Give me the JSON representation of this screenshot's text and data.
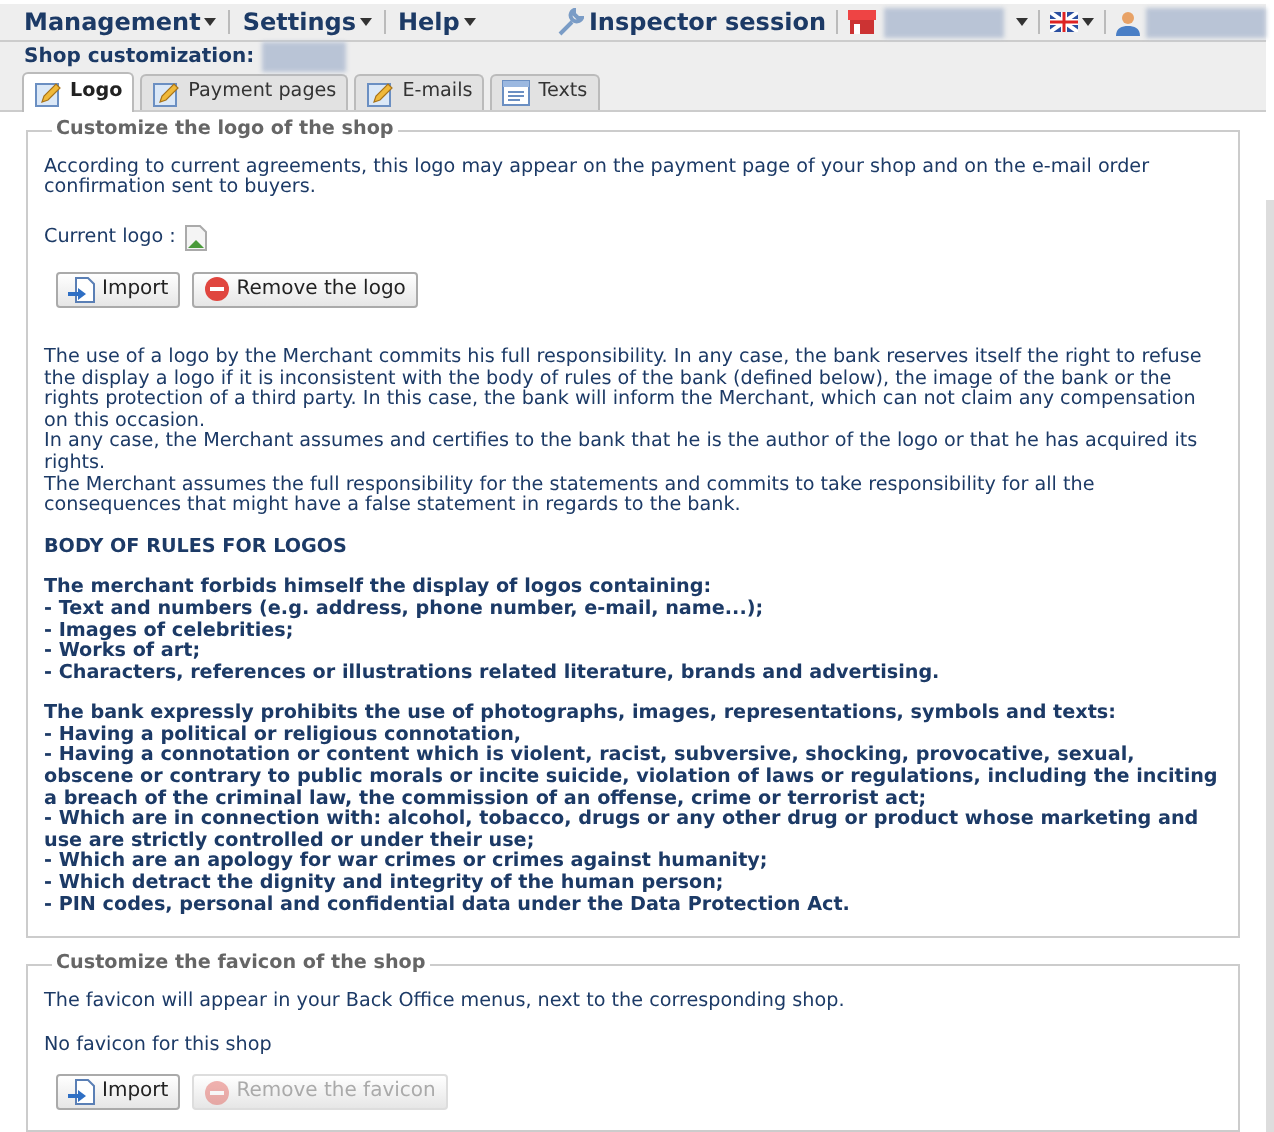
{
  "menu": [
    {
      "label": "Management"
    },
    {
      "label": "Settings"
    },
    {
      "label": "Help"
    }
  ],
  "session": {
    "label": "Inspector session"
  },
  "page_title": {
    "label": "Shop customization:"
  },
  "tabs": [
    {
      "label": "Logo",
      "selected": true,
      "kind": "edit"
    },
    {
      "label": "Payment pages",
      "selected": false,
      "kind": "edit"
    },
    {
      "label": "E-mails",
      "selected": false,
      "kind": "edit"
    },
    {
      "label": "Texts",
      "selected": false,
      "kind": "list"
    }
  ],
  "logo_section": {
    "legend": "Customize the logo of the shop",
    "intro": "According to current agreements, this logo may appear on the payment page of your shop and on the e-mail order confirmation sent to buyers.",
    "current_logo_label": "Current logo :",
    "buttons": [
      {
        "label": "Import",
        "kind": "import",
        "disabled": false
      },
      {
        "label": "Remove the logo",
        "kind": "remove",
        "disabled": false
      }
    ],
    "paragraphs": [
      "The use of a logo by the Merchant commits his full responsibility. In any case, the bank reserves itself the right to refuse the display a logo if it is inconsistent with the body of rules of the bank (defined below), the image of the bank or the rights protection of a third party. In this case, the bank will inform the Merchant, which can not claim any compensation on this occasion.",
      "In any case, the Merchant assumes and certifies to the bank that he is the author of the logo or that he has acquired its rights.",
      "The Merchant assumes the full responsibility for the statements and commits to take responsibility for all the consequences that might have a false statement in regards to the bank."
    ],
    "rules_title": "BODY OF RULES FOR LOGOS",
    "rule_groups": [
      {
        "heading": "The merchant forbids himself the display of logos containing:",
        "items": [
          "- Text and numbers (e.g. address, phone number, e-mail, name...);",
          "- Images of celebrities;",
          "- Works of art;",
          "- Characters, references or illustrations related literature, brands and advertising."
        ]
      },
      {
        "heading": "The bank expressly prohibits the use of photographs, images, representations, symbols and texts:",
        "items": [
          "- Having a political or religious connotation,",
          "- Having a connotation or content which is violent, racist, subversive, shocking, provocative, sexual, obscene or contrary to public morals or incite suicide, violation of laws or regulations, including the inciting a breach of the criminal law, the commission of an offense, crime or terrorist act;",
          "- Which are in connection with: alcohol, tobacco, drugs or any other drug or product whose marketing and use are strictly controlled or under their use;",
          "- Which are an apology for war crimes or crimes against humanity;",
          "- Which detract the dignity and integrity of the human person;",
          "- PIN codes, personal and confidential data under the Data Protection Act."
        ]
      }
    ]
  },
  "favicon_section": {
    "legend": "Customize the favicon of the shop",
    "intro": "The favicon will appear in your Back Office menus, next to the corresponding shop.",
    "status": "No favicon for this shop",
    "buttons": [
      {
        "label": "Import",
        "kind": "import",
        "disabled": false
      },
      {
        "label": "Remove the favicon",
        "kind": "remove",
        "disabled": true
      }
    ]
  }
}
